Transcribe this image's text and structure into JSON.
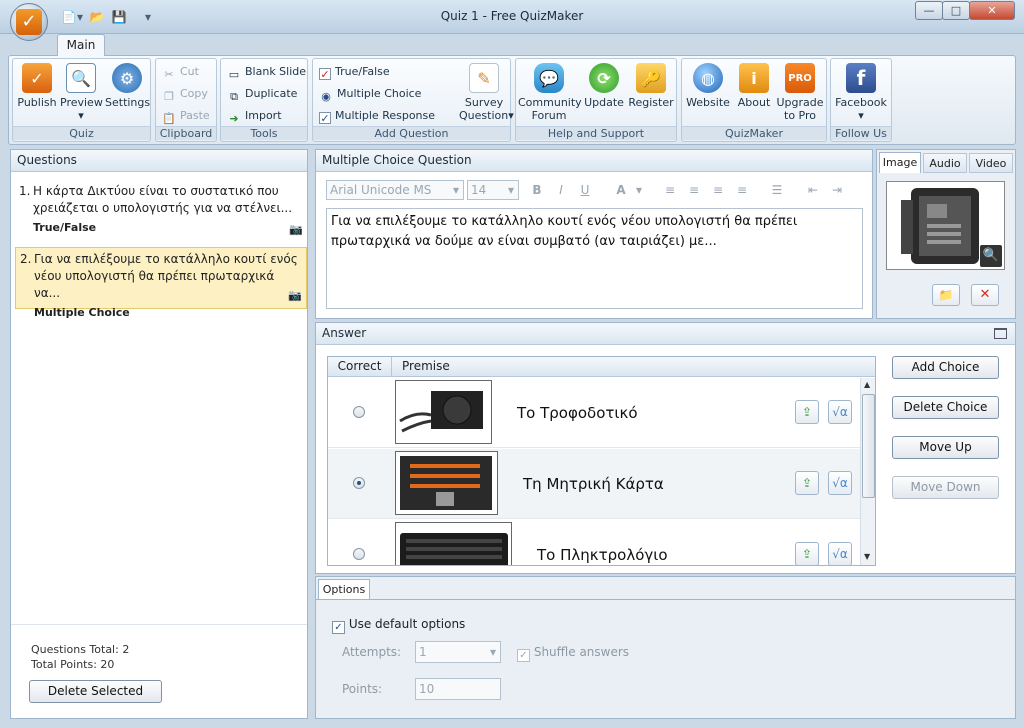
{
  "window": {
    "title": "Quiz 1 - Free QuizMaker",
    "minimize": "—",
    "maximize": "□",
    "close": "✕"
  },
  "orb_letter": "✓",
  "qat": {
    "new": "📄",
    "dropdown": "▾",
    "open": "📂",
    "save": "💾",
    "customize": "▾"
  },
  "ribbon": {
    "tab": "Main",
    "quiz": {
      "label": "Quiz",
      "publish": "Publish",
      "preview": "Preview",
      "preview_arrow": "▾",
      "settings": "Settings"
    },
    "clipboard": {
      "label": "Clipboard",
      "cut": "Cut",
      "copy": "Copy",
      "paste": "Paste"
    },
    "tools": {
      "label": "Tools",
      "blank_slide": "Blank Slide",
      "duplicate": "Duplicate",
      "import": "Import"
    },
    "add_question": {
      "label": "Add Question",
      "true_false": "True/False",
      "multiple_choice": "Multiple Choice",
      "multiple_response": "Multiple Response",
      "survey_line1": "Survey",
      "survey_line2": "Question",
      "survey_arrow": "▾"
    },
    "help": {
      "label": "Help and Support",
      "forum_line1": "Community",
      "forum_line2": "Forum",
      "update": "Update",
      "register": "Register"
    },
    "quizmaker": {
      "label": "QuizMaker",
      "website": "Website",
      "about": "About",
      "upgrade_line1": "Upgrade",
      "upgrade_line2": "to Pro",
      "pro_badge": "PRO"
    },
    "follow": {
      "label": "Follow Us",
      "facebook": "Facebook",
      "facebook_arrow": "▾",
      "fb_letter": "f"
    }
  },
  "questions": {
    "header": "Questions",
    "items": [
      {
        "num": "1.",
        "text": "Η κάρτα Δικτύου είναι το συστατικό που χρειάζεται ο υπολογιστής για να στέλνει...",
        "type": "True/False"
      },
      {
        "num": "2.",
        "text": "Για να επιλέξουμε το κατάλληλο κουτί ενός νέου υπολογιστή θα πρέπει πρωταρχικά να...",
        "type": "Multiple Choice"
      }
    ],
    "total_questions": "Questions Total: 2",
    "total_points": "Total Points: 20",
    "delete_selected": "Delete Selected"
  },
  "editor": {
    "header": "Multiple Choice Question",
    "font": "Arial Unicode MS",
    "size": "14",
    "bold": "B",
    "italic": "I",
    "underline": "U",
    "font_color": "A",
    "text": "Για να επιλέξουμε το κατάλληλο κουτί ενός νέου υπολογιστή θα πρέπει πρωταρχικά να δούμε αν είναι συμβατό (αν ταιριάζει) με..."
  },
  "media": {
    "tab_image": "Image",
    "tab_audio": "Audio",
    "tab_video": "Video",
    "zoom": "🔍",
    "folder": "📁",
    "delete": "✕"
  },
  "answer": {
    "header": "Answer",
    "col_correct": "Correct",
    "col_premise": "Premise",
    "choices": [
      {
        "text": "Το Τροφοδοτικό"
      },
      {
        "text": "Τη Μητρική Κάρτα"
      },
      {
        "text": "Το Πληκτρολόγιο"
      }
    ],
    "add_choice": "Add Choice",
    "delete_choice": "Delete Choice",
    "move_up": "Move Up",
    "move_down": "Move Down",
    "formula_icon": "√α"
  },
  "options": {
    "tab": "Options",
    "use_default": "Use default options",
    "attempts_label": "Attempts:",
    "attempts_value": "1",
    "shuffle": "Shuffle answers",
    "points_label": "Points:",
    "points_value": "10",
    "check_mark": "✓"
  }
}
